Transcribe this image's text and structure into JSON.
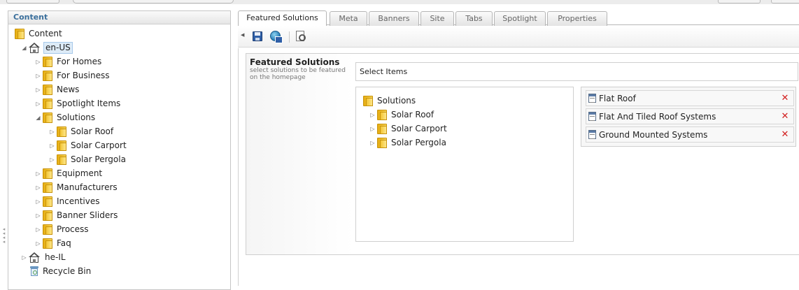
{
  "content_panel": {
    "header": "Content",
    "tree": [
      {
        "label": "Content",
        "icon": "folder-icon",
        "expander": "none"
      },
      {
        "label": "en-US",
        "icon": "house-icon",
        "expander": "expanded",
        "selected": true
      },
      {
        "label": "For Homes",
        "icon": "folder-icon",
        "expander": "collapsed"
      },
      {
        "label": "For Business",
        "icon": "folder-icon",
        "expander": "collapsed"
      },
      {
        "label": "News",
        "icon": "folder-icon",
        "expander": "collapsed"
      },
      {
        "label": "Spotlight Items",
        "icon": "folder-icon",
        "expander": "collapsed"
      },
      {
        "label": "Solutions",
        "icon": "folder-icon",
        "expander": "expanded"
      },
      {
        "label": "Solar Roof",
        "icon": "folder-icon",
        "expander": "collapsed"
      },
      {
        "label": "Solar Carport",
        "icon": "folder-icon",
        "expander": "collapsed"
      },
      {
        "label": "Solar Pergola",
        "icon": "folder-icon",
        "expander": "collapsed"
      },
      {
        "label": "Equipment",
        "icon": "folder-icon",
        "expander": "collapsed"
      },
      {
        "label": "Manufacturers",
        "icon": "folder-icon",
        "expander": "collapsed"
      },
      {
        "label": "Incentives",
        "icon": "folder-icon",
        "expander": "collapsed"
      },
      {
        "label": "Banner Sliders",
        "icon": "folder-icon",
        "expander": "collapsed"
      },
      {
        "label": "Process",
        "icon": "folder-icon",
        "expander": "collapsed"
      },
      {
        "label": "Faq",
        "icon": "folder-icon",
        "expander": "collapsed"
      },
      {
        "label": "he-IL",
        "icon": "house-icon",
        "expander": "collapsed"
      },
      {
        "label": "Recycle Bin",
        "icon": "recycle-bin-icon",
        "expander": "none"
      }
    ]
  },
  "tabs": [
    {
      "label": "Featured Solutions",
      "active": true
    },
    {
      "label": "Meta",
      "active": false
    },
    {
      "label": "Banners",
      "active": false
    },
    {
      "label": "Site",
      "active": false
    },
    {
      "label": "Tabs",
      "active": false
    },
    {
      "label": "Spotlight",
      "active": false
    },
    {
      "label": "Properties",
      "active": false
    }
  ],
  "toolbar": {
    "buttons": [
      "save-icon",
      "save-and-publish-icon",
      "preview-icon"
    ]
  },
  "field": {
    "title": "Featured Solutions",
    "help": "select solutions to be featured on the homepage",
    "picker_header": "Select Items",
    "source_tree": [
      {
        "label": "Solutions",
        "expander": "none"
      },
      {
        "label": "Solar Roof",
        "expander": "collapsed"
      },
      {
        "label": "Solar Carport",
        "expander": "collapsed"
      },
      {
        "label": "Solar Pergola",
        "expander": "collapsed"
      }
    ],
    "selected_items": [
      {
        "label": "Flat Roof",
        "remove_glyph": "✕"
      },
      {
        "label": "Flat And Tiled Roof Systems",
        "remove_glyph": "✕"
      },
      {
        "label": "Ground Mounted Systems",
        "remove_glyph": "✕"
      }
    ]
  }
}
